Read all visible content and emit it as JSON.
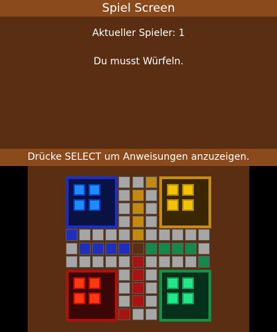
{
  "top": {
    "title": "Spiel Screen",
    "player_line": "Aktueller Spieler: 1",
    "message": "Du musst Würfeln.",
    "hint": "Drücke SELECT um Anweisungen anzuzeigen."
  },
  "colors": {
    "background": "#5a2e12",
    "bar": "#8a4a1c",
    "track": "#a6a6a6",
    "blue": "#1e2fbe",
    "yellow": "#c28a12",
    "green": "#138a4a",
    "red": "#a81414",
    "center": "#5a2e12"
  },
  "players": [
    {
      "id": "blue",
      "pawns_at_home": 4
    },
    {
      "id": "yellow",
      "pawns_at_home": 4
    },
    {
      "id": "red",
      "pawns_at_home": 4
    },
    {
      "id": "green",
      "pawns_at_home": 4
    }
  ]
}
